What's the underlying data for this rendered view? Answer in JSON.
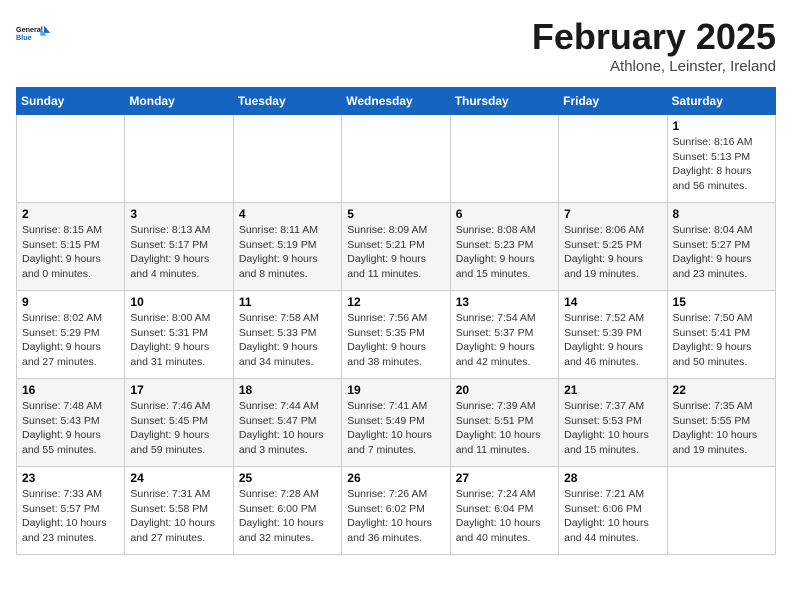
{
  "logo": {
    "line1": "General",
    "line2": "Blue"
  },
  "title": "February 2025",
  "subtitle": "Athlone, Leinster, Ireland",
  "days_of_week": [
    "Sunday",
    "Monday",
    "Tuesday",
    "Wednesday",
    "Thursday",
    "Friday",
    "Saturday"
  ],
  "weeks": [
    [
      {
        "day": "",
        "info": ""
      },
      {
        "day": "",
        "info": ""
      },
      {
        "day": "",
        "info": ""
      },
      {
        "day": "",
        "info": ""
      },
      {
        "day": "",
        "info": ""
      },
      {
        "day": "",
        "info": ""
      },
      {
        "day": "1",
        "info": "Sunrise: 8:16 AM\nSunset: 5:13 PM\nDaylight: 8 hours and 56 minutes."
      }
    ],
    [
      {
        "day": "2",
        "info": "Sunrise: 8:15 AM\nSunset: 5:15 PM\nDaylight: 9 hours and 0 minutes."
      },
      {
        "day": "3",
        "info": "Sunrise: 8:13 AM\nSunset: 5:17 PM\nDaylight: 9 hours and 4 minutes."
      },
      {
        "day": "4",
        "info": "Sunrise: 8:11 AM\nSunset: 5:19 PM\nDaylight: 9 hours and 8 minutes."
      },
      {
        "day": "5",
        "info": "Sunrise: 8:09 AM\nSunset: 5:21 PM\nDaylight: 9 hours and 11 minutes."
      },
      {
        "day": "6",
        "info": "Sunrise: 8:08 AM\nSunset: 5:23 PM\nDaylight: 9 hours and 15 minutes."
      },
      {
        "day": "7",
        "info": "Sunrise: 8:06 AM\nSunset: 5:25 PM\nDaylight: 9 hours and 19 minutes."
      },
      {
        "day": "8",
        "info": "Sunrise: 8:04 AM\nSunset: 5:27 PM\nDaylight: 9 hours and 23 minutes."
      }
    ],
    [
      {
        "day": "9",
        "info": "Sunrise: 8:02 AM\nSunset: 5:29 PM\nDaylight: 9 hours and 27 minutes."
      },
      {
        "day": "10",
        "info": "Sunrise: 8:00 AM\nSunset: 5:31 PM\nDaylight: 9 hours and 31 minutes."
      },
      {
        "day": "11",
        "info": "Sunrise: 7:58 AM\nSunset: 5:33 PM\nDaylight: 9 hours and 34 minutes."
      },
      {
        "day": "12",
        "info": "Sunrise: 7:56 AM\nSunset: 5:35 PM\nDaylight: 9 hours and 38 minutes."
      },
      {
        "day": "13",
        "info": "Sunrise: 7:54 AM\nSunset: 5:37 PM\nDaylight: 9 hours and 42 minutes."
      },
      {
        "day": "14",
        "info": "Sunrise: 7:52 AM\nSunset: 5:39 PM\nDaylight: 9 hours and 46 minutes."
      },
      {
        "day": "15",
        "info": "Sunrise: 7:50 AM\nSunset: 5:41 PM\nDaylight: 9 hours and 50 minutes."
      }
    ],
    [
      {
        "day": "16",
        "info": "Sunrise: 7:48 AM\nSunset: 5:43 PM\nDaylight: 9 hours and 55 minutes."
      },
      {
        "day": "17",
        "info": "Sunrise: 7:46 AM\nSunset: 5:45 PM\nDaylight: 9 hours and 59 minutes."
      },
      {
        "day": "18",
        "info": "Sunrise: 7:44 AM\nSunset: 5:47 PM\nDaylight: 10 hours and 3 minutes."
      },
      {
        "day": "19",
        "info": "Sunrise: 7:41 AM\nSunset: 5:49 PM\nDaylight: 10 hours and 7 minutes."
      },
      {
        "day": "20",
        "info": "Sunrise: 7:39 AM\nSunset: 5:51 PM\nDaylight: 10 hours and 11 minutes."
      },
      {
        "day": "21",
        "info": "Sunrise: 7:37 AM\nSunset: 5:53 PM\nDaylight: 10 hours and 15 minutes."
      },
      {
        "day": "22",
        "info": "Sunrise: 7:35 AM\nSunset: 5:55 PM\nDaylight: 10 hours and 19 minutes."
      }
    ],
    [
      {
        "day": "23",
        "info": "Sunrise: 7:33 AM\nSunset: 5:57 PM\nDaylight: 10 hours and 23 minutes."
      },
      {
        "day": "24",
        "info": "Sunrise: 7:31 AM\nSunset: 5:58 PM\nDaylight: 10 hours and 27 minutes."
      },
      {
        "day": "25",
        "info": "Sunrise: 7:28 AM\nSunset: 6:00 PM\nDaylight: 10 hours and 32 minutes."
      },
      {
        "day": "26",
        "info": "Sunrise: 7:26 AM\nSunset: 6:02 PM\nDaylight: 10 hours and 36 minutes."
      },
      {
        "day": "27",
        "info": "Sunrise: 7:24 AM\nSunset: 6:04 PM\nDaylight: 10 hours and 40 minutes."
      },
      {
        "day": "28",
        "info": "Sunrise: 7:21 AM\nSunset: 6:06 PM\nDaylight: 10 hours and 44 minutes."
      },
      {
        "day": "",
        "info": ""
      }
    ]
  ]
}
